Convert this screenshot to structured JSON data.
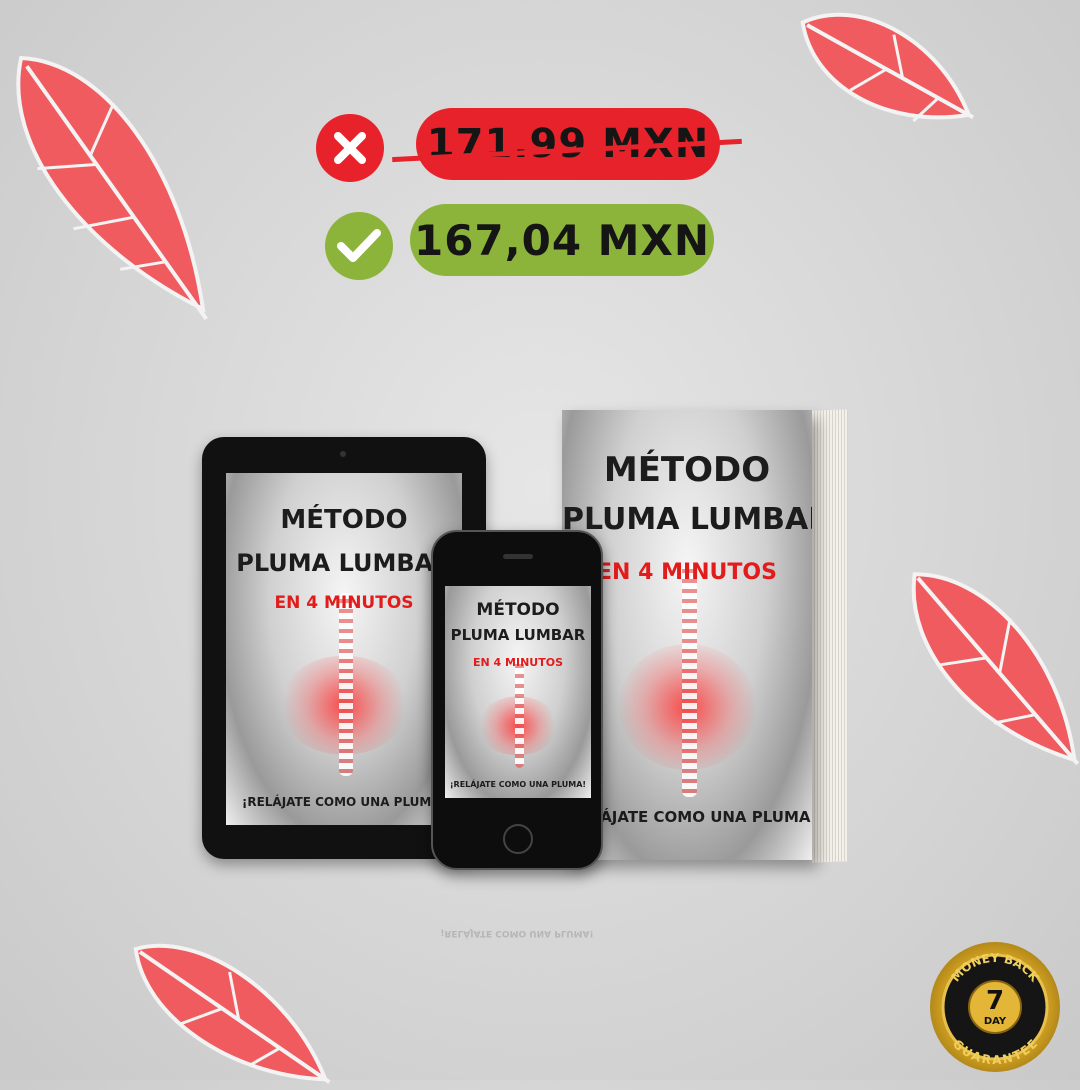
{
  "prices": {
    "old_price": "171.99 MXN",
    "new_price": "167,04 MXN"
  },
  "cover": {
    "title_line1": "MÉTODO",
    "title_line2": "PLUMA LUMBAR",
    "subtitle": "EN 4 MINUTOS",
    "tagline": "¡RELÁJATE COMO UNA PLUMA!"
  },
  "badge": {
    "top_text": "MONEY BACK",
    "number": "7",
    "unit": "DAY",
    "bottom_text": "GUARANTEE"
  },
  "icons": {
    "x": "x-icon",
    "check": "check-icon",
    "feather": "feather-icon"
  },
  "colors": {
    "red": "#e8222a",
    "green": "#8db43a",
    "feather": "#ef5b5e",
    "gold": "#d9a82a"
  }
}
